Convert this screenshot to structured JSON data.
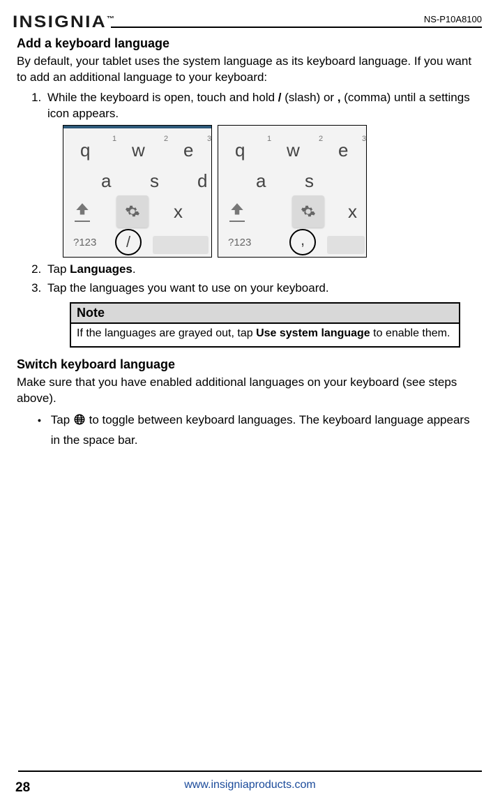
{
  "header": {
    "logo": "INSIGNIA",
    "model": "NS-P10A8100"
  },
  "section1": {
    "title": "Add a keyboard language",
    "intro": "By default, your tablet uses the system language as its keyboard language. If you want to add an additional language to your keyboard:",
    "step1_a": "While the keyboard is open, touch and hold ",
    "step1_slash": "/",
    "step1_b": " (slash) or ",
    "step1_comma": ",",
    "step1_c": " (comma) until a settings icon appears.",
    "step2_a": "Tap ",
    "step2_b": "Languages",
    "step2_c": ".",
    "step3": "Tap the languages you want to use on your keyboard."
  },
  "kbd": {
    "q": "q",
    "w": "w",
    "e": "e",
    "a": "a",
    "s": "s",
    "d": "d",
    "x": "x",
    "n1": "1",
    "n2": "2",
    "n3": "3",
    "sym": "?123",
    "slash": "/",
    "comma": ","
  },
  "note": {
    "head": "Note",
    "body_a": "If the languages are grayed out, tap ",
    "body_b": "Use system language",
    "body_c": " to enable them."
  },
  "section2": {
    "title": "Switch keyboard language",
    "intro": "Make sure that you have enabled additional languages on your keyboard (see steps above).",
    "bullet_a": "Tap ",
    "bullet_b": " to toggle between keyboard languages. The keyboard language appears in the space bar."
  },
  "footer": {
    "url": "www.insigniaproducts.com",
    "page": "28"
  }
}
